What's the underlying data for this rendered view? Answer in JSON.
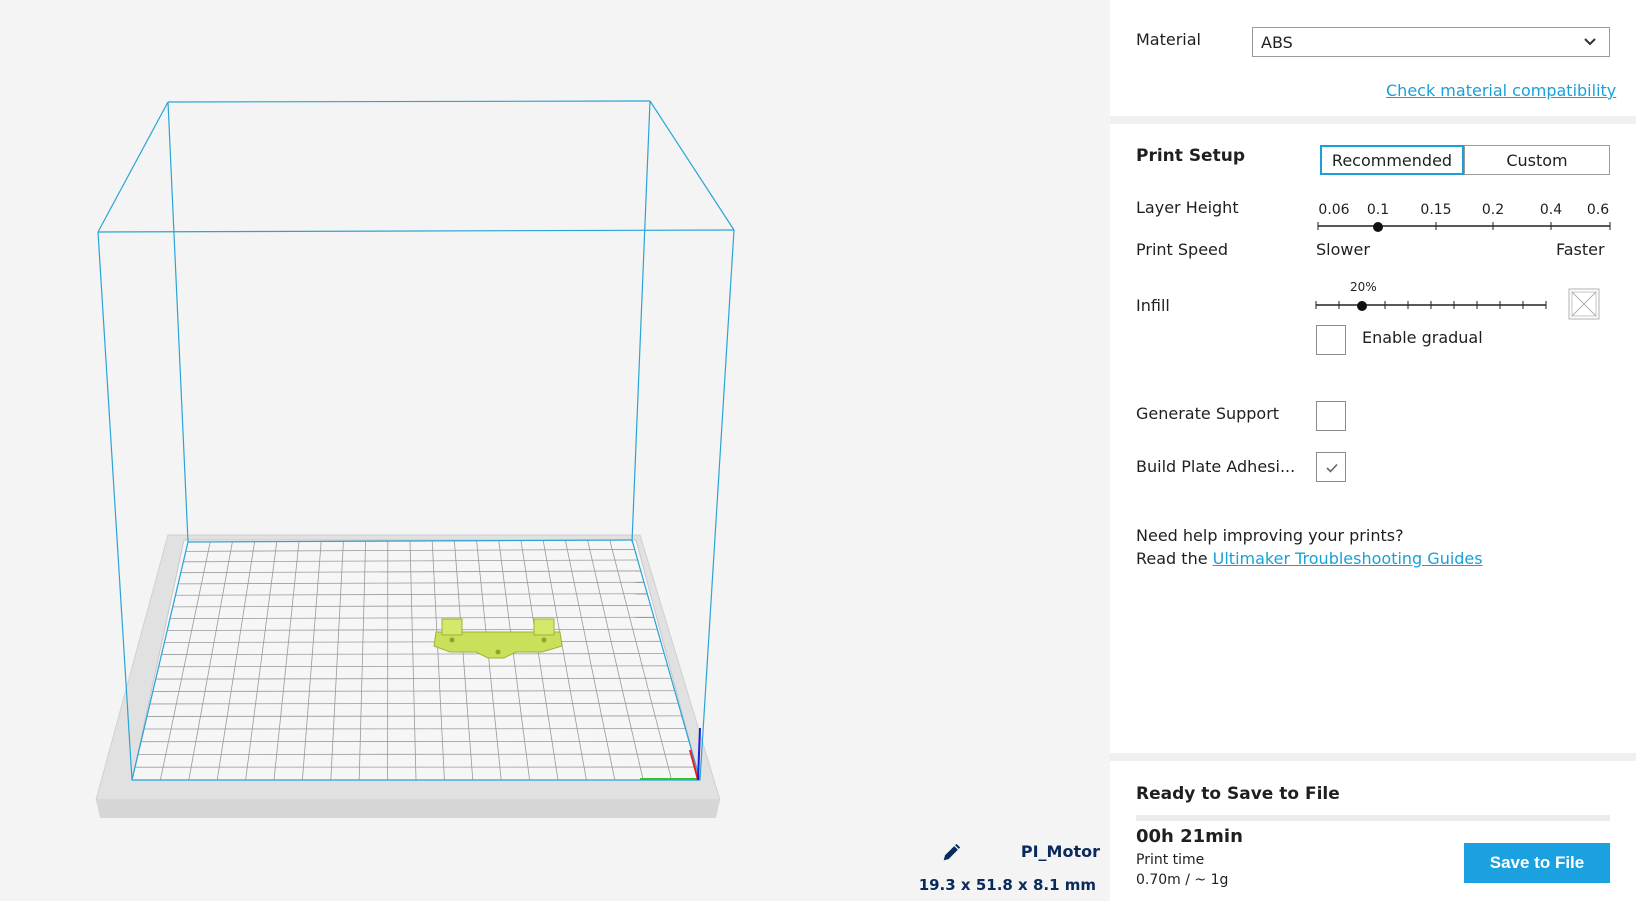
{
  "model": {
    "name": "PI_Motor",
    "dimensions": "19.3 x 51.8 x 8.1 mm"
  },
  "material": {
    "label": "Material",
    "value": "ABS",
    "compat_link": "Check material compatibility"
  },
  "print_setup": {
    "title": "Print Setup",
    "mode_recommended": "Recommended",
    "mode_custom": "Custom",
    "layer_height_label": "Layer Height",
    "layer_ticks": [
      "0.06",
      "0.1",
      "0.15",
      "0.2",
      "0.4",
      "0.6"
    ],
    "layer_selected": "0.1",
    "speed_label": "Print Speed",
    "speed_slower": "Slower",
    "speed_faster": "Faster",
    "infill_label": "Infill",
    "infill_value": "20%",
    "enable_gradual_label": "Enable gradual",
    "enable_gradual_checked": false,
    "support_label": "Generate Support",
    "support_checked": false,
    "adhesion_label": "Build Plate Adhesi...",
    "adhesion_checked": true
  },
  "help": {
    "line1": "Need help improving your prints?",
    "line2_prefix": "Read the",
    "line2_link": "Ultimaker Troubleshooting Guides"
  },
  "output": {
    "status": "Ready to Save to File",
    "print_time": "00h 21min",
    "print_time_label": "Print time",
    "material_usage": "0.70m / ~ 1g",
    "save_button": "Save to File"
  },
  "colors": {
    "accent": "#1aa0d8",
    "build_volume": "#2aa4d6",
    "model": "#c9e05a"
  }
}
